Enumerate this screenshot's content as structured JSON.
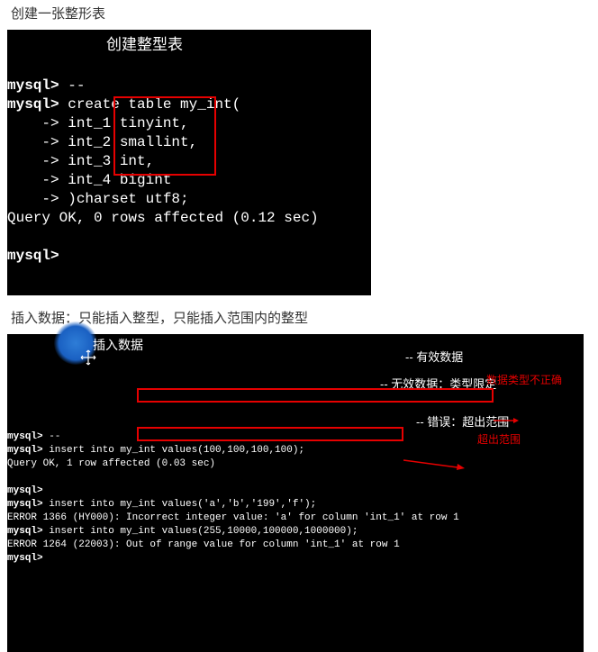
{
  "heading1": "创建一张整形表",
  "heading2": "插入数据：只能插入整型，只能插入范围内的整型",
  "term1": {
    "l1_prompt": "mysql>",
    "l1_rest": " --",
    "l1_comment": "创建整型表",
    "l2_prompt": "mysql>",
    "l2_rest": " create table my_int(",
    "l3": "    -> int_1 tinyint,",
    "l4": "    -> int_2 smallint,",
    "l5": "    -> int_3 int,",
    "l6": "    -> int_4 bigint",
    "l7": "    -> )charset utf8;",
    "l8": "Query OK, 0 rows affected (0.12 sec)",
    "l9": "",
    "l10_prompt": "mysql>"
  },
  "term2": {
    "l1_prompt": "mysql>",
    "l1_rest": " --",
    "l1_comment": "插入数据",
    "l2_prompt": "mysql>",
    "l2_rest": " insert into my_int values(100,100,100,100);",
    "l2_cmt": "-- 有效数据",
    "l3": "Query OK, 1 row affected (0.03 sec)",
    "l4": "",
    "l5_prompt": "mysql>",
    "l6_prompt": "mysql>",
    "l6_rest": " insert into my_int values('a','b','199','f');",
    "l6_cmt": "-- 无效数据：类型限定",
    "l7": "ERROR 1366 (HY000): Incorrect integer value: 'a' for column 'int_1' at row 1",
    "l8_prompt": "mysql>",
    "l8_rest": " insert into my_int values(255,10000,100000,1000000);",
    "l8_cmt": "-- 错误：超出范围",
    "l9": "ERROR 1264 (22003): Out of range value for column 'int_1' at row 1",
    "l10_prompt": "mysql>"
  },
  "annotations": {
    "a1": "数据类型不正确",
    "a2": "超出范围"
  }
}
